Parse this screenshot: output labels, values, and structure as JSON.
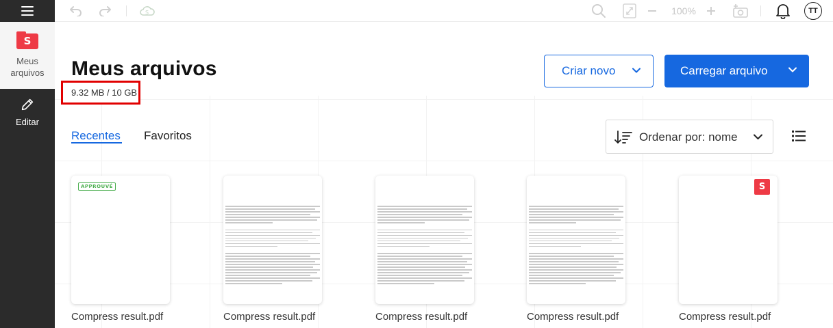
{
  "sidebar": {
    "menu_icon": "hamburger-menu-icon",
    "items": [
      {
        "label": "Meus arquivos",
        "icon": "folder-s-logo-icon",
        "active": true
      },
      {
        "label": "Editar",
        "icon": "pencil-icon",
        "active": false
      }
    ],
    "logo_letter": "S"
  },
  "toolbar": {
    "zoom_level": "100%",
    "avatar_initials": "TT",
    "icons": [
      "undo-icon",
      "redo-icon",
      "cloud-sync-icon",
      "search-icon",
      "fit-page-icon",
      "zoom-out-icon",
      "zoom-in-icon",
      "add-photo-icon",
      "bell-icon"
    ]
  },
  "header": {
    "title": "Meus arquivos",
    "storage": "9.32 MB / 10 GB",
    "create_button": "Criar novo",
    "upload_button": "Carregar arquivo"
  },
  "tabs": [
    {
      "label": "Recentes",
      "active": true
    },
    {
      "label": "Favoritos",
      "active": false
    }
  ],
  "sort": {
    "label": "Ordenar por: nome"
  },
  "files": [
    {
      "name": "Compress result.pdf",
      "thumbnail": "approved-stamp",
      "stamp_text": "APPROUVÉ"
    },
    {
      "name": "Compress result.pdf",
      "thumbnail": "text-lines"
    },
    {
      "name": "Compress result.pdf",
      "thumbnail": "text-lines"
    },
    {
      "name": "Compress result.pdf",
      "thumbnail": "text-lines"
    },
    {
      "name": "Compress result.pdf",
      "thumbnail": "s-logo",
      "badge": "S"
    }
  ],
  "colors": {
    "accent": "#1668e0",
    "brand_red": "#ee3a45",
    "sidebar_bg": "#2b2b2b",
    "highlight_box": "#e10000",
    "stamp_green": "#4caf50"
  }
}
